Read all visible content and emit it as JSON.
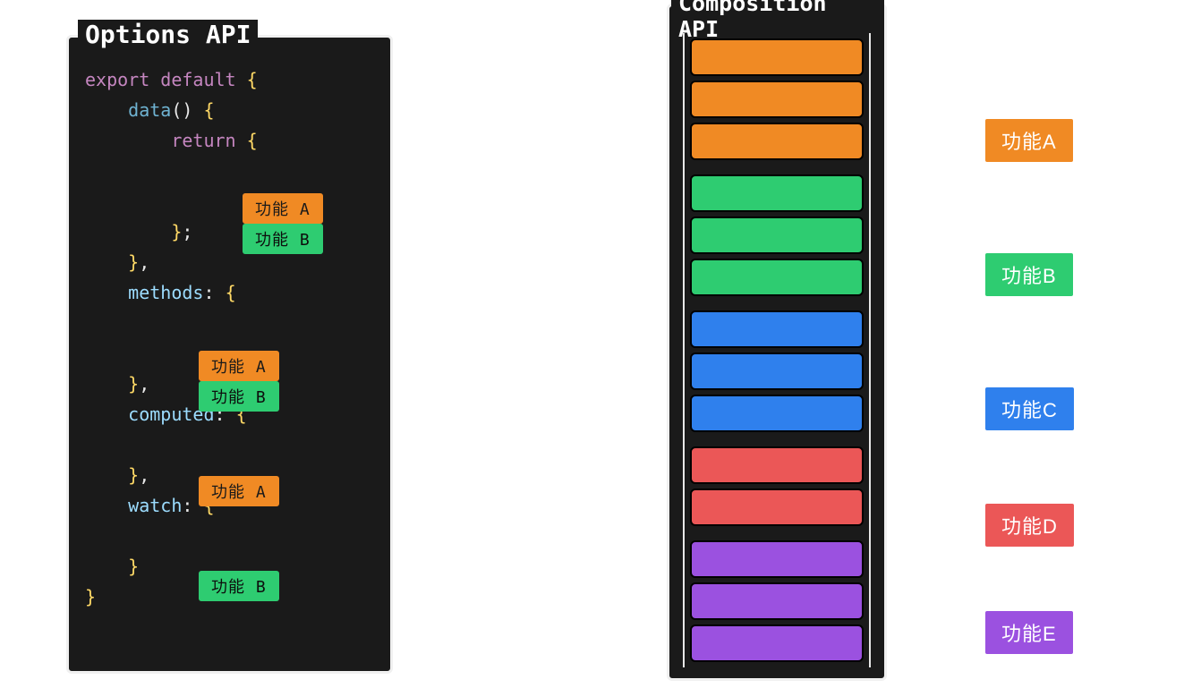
{
  "options_panel": {
    "title": "Options API",
    "code": {
      "export": "export",
      "default": "default",
      "data": "data",
      "return": "return",
      "methods": "methods",
      "computed": "computed",
      "watch": "watch"
    },
    "chips": {
      "data_a": "功能 A",
      "data_b": "功能 B",
      "methods_a": "功能 A",
      "methods_b": "功能 B",
      "computed_a": "功能 A",
      "watch_b": "功能 B"
    }
  },
  "composition_panel": {
    "title": "Composition API",
    "groups": [
      {
        "color": "orange",
        "count": 3
      },
      {
        "color": "green",
        "count": 3
      },
      {
        "color": "blue",
        "count": 3
      },
      {
        "color": "red",
        "count": 2
      },
      {
        "color": "purple",
        "count": 3
      }
    ]
  },
  "legend": {
    "a": "功能A",
    "b": "功能B",
    "c": "功能C",
    "d": "功能D",
    "e": "功能E"
  },
  "colors": {
    "orange": "#f08a24",
    "green": "#2ecc71",
    "blue": "#2f80ed",
    "red": "#eb5757",
    "purple": "#9b51e0"
  }
}
